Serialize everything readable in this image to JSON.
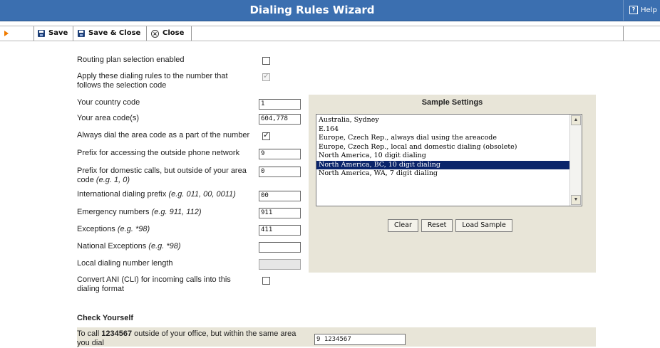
{
  "window": {
    "title": "Dialing Rules Wizard",
    "help_label": "Help",
    "help_glyph": "?"
  },
  "toolbar": {
    "save_label": "Save",
    "save_close_label": "Save & Close",
    "close_label": "Close"
  },
  "form": {
    "routing_plan_label": "Routing plan selection enabled",
    "routing_plan_checked": false,
    "apply_rules_label": "Apply these dialing rules to the number that follows the selection code",
    "apply_rules_checked": true,
    "country_code_label": "Your country code",
    "country_code_value": "1",
    "area_codes_label": "Your area code(s)",
    "area_codes_value": "604,778",
    "always_dial_area_label": "Always dial the area code as a part of the number",
    "always_dial_area_checked": true,
    "outside_prefix_label": "Prefix for accessing the outside phone network",
    "outside_prefix_value": "9",
    "domestic_prefix_label": "Prefix for domestic calls, but outside of your area code",
    "domestic_prefix_hint": "(e.g. 1, 0)",
    "domestic_prefix_value": "0",
    "intl_prefix_label": "International dialing prefix",
    "intl_prefix_hint": "(e.g. 011, 00, 0011)",
    "intl_prefix_value": "00",
    "emergency_label": "Emergency numbers",
    "emergency_hint": "(e.g. 911, 112)",
    "emergency_value": "911",
    "exceptions_label": "Exceptions",
    "exceptions_hint": "(e.g. *98)",
    "exceptions_value": "411",
    "national_exceptions_label": "National Exceptions",
    "national_exceptions_hint": "(e.g. *98)",
    "national_exceptions_value": "",
    "local_length_label": "Local dialing number length",
    "local_length_value": "",
    "convert_ani_label": "Convert ANI (CLI) for incoming calls into this dialing format",
    "convert_ani_checked": false,
    "check_mark": "✓"
  },
  "sample": {
    "title": "Sample Settings",
    "items": [
      "Australia, Sydney",
      "E.164",
      "Europe, Czech Rep., always dial using the areacode",
      "Europe, Czech Rep., local and domestic dialing (obsolete)",
      "North America, 10 digit dialing",
      "North America, BC, 10 digit dialing",
      "North America, WA, 7 digit dialing"
    ],
    "selected_index": 5,
    "clear_label": "Clear",
    "reset_label": "Reset",
    "load_label": "Load Sample"
  },
  "check": {
    "heading": "Check Yourself",
    "text_prefix": "To call ",
    "number": "1234567",
    "text_suffix": " outside of your office, but within the same area you dial",
    "result_value": "9 1234567"
  }
}
